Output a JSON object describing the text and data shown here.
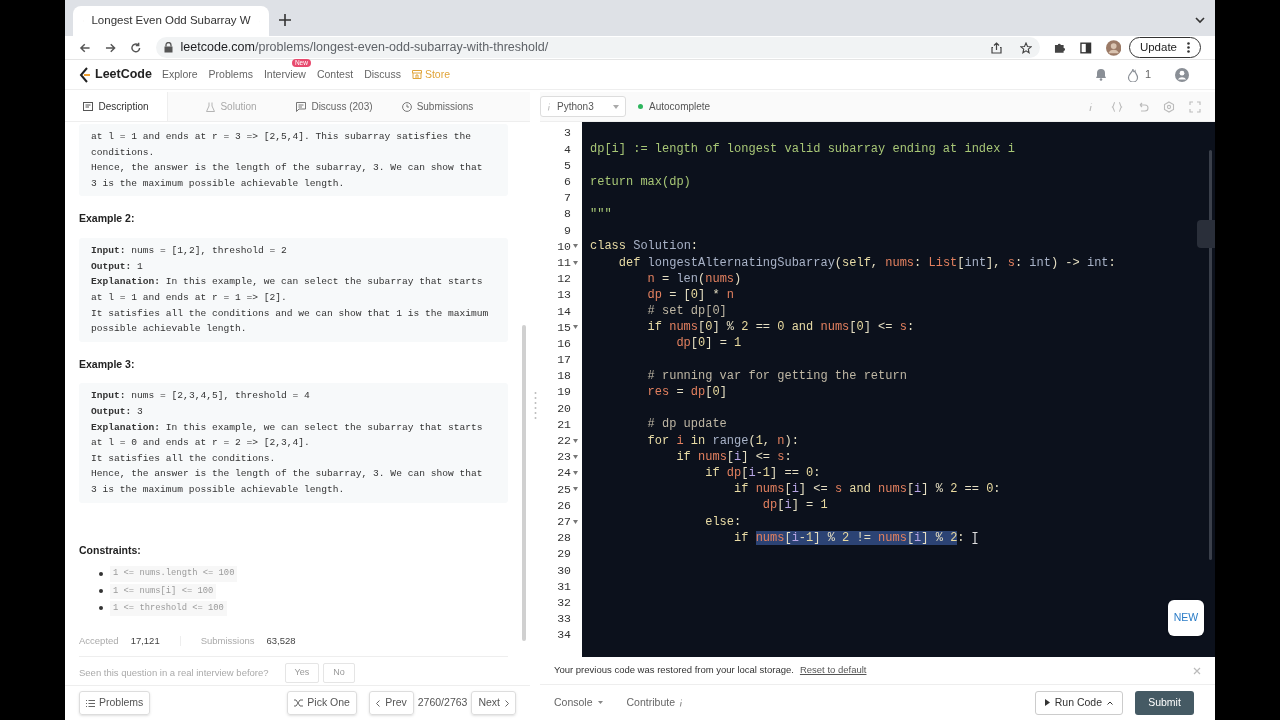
{
  "browser": {
    "tab_title": "Longest Even Odd Subarray W",
    "url_domain": "leetcode.com",
    "url_path": "/problems/longest-even-odd-subarray-with-threshold/",
    "update_label": "Update"
  },
  "nav": {
    "brand": "LeetCode",
    "links": [
      {
        "label": "Explore",
        "kind": "plain"
      },
      {
        "label": "Problems",
        "kind": "plain"
      },
      {
        "label": "Interview",
        "kind": "badged",
        "badge": "New"
      },
      {
        "label": "Contest",
        "kind": "plain"
      },
      {
        "label": "Discuss",
        "kind": "plain"
      },
      {
        "label": "Store",
        "kind": "store"
      }
    ],
    "streak": "1"
  },
  "panel_tabs": [
    {
      "label": "Description",
      "selected": true,
      "disabled": false
    },
    {
      "label": "Solution",
      "selected": false,
      "disabled": true
    },
    {
      "label": "Discuss (203)",
      "selected": false,
      "disabled": false
    },
    {
      "label": "Submissions",
      "selected": false,
      "disabled": false
    }
  ],
  "description": [
    {
      "kind": "box",
      "lines": [
        "at l = 1 and ends at r = 3 => [2,5,4]. This subarray satisfies the",
        "conditions.",
        "Hence, the answer is the length of the subarray, 3. We can show that",
        "3 is the maximum possible achievable length."
      ]
    },
    {
      "kind": "heading",
      "text": "Example 2:"
    },
    {
      "kind": "box",
      "lines": [
        "**Input:** nums = [1,2], threshold = 2",
        "**Output:** 1",
        "**Explanation:** In this example, we can select the subarray that starts",
        "at l = 1 and ends at r = 1 => [2].",
        "It satisfies all the conditions and we can show that 1 is the maximum",
        "possible achievable length."
      ]
    },
    {
      "kind": "heading",
      "text": "Example 3:"
    },
    {
      "kind": "box",
      "lines": [
        "**Input:** nums = [2,3,4,5], threshold = 4",
        "**Output:** 3",
        "**Explanation:** In this example, we can select the subarray that starts",
        "at l = 0 and ends at r = 2 => [2,3,4].",
        "It satisfies all the conditions.",
        "Hence, the answer is the length of the subarray, 3. We can show that",
        "3 is the maximum possible achievable length."
      ]
    },
    {
      "kind": "constraints",
      "title": "Constraints:",
      "items": [
        "1 <= nums.length <= 100",
        "1 <= nums[i] <= 100",
        "1 <= threshold <= 100"
      ]
    }
  ],
  "stats": [
    {
      "label": "Accepted",
      "value": "17,121"
    },
    {
      "label": "Submissions",
      "value": "63,528"
    }
  ],
  "feedback": {
    "question": "Seen this question in a real interview before?",
    "options": [
      "Yes",
      "No"
    ]
  },
  "left_footer": {
    "problems": "Problems",
    "pick_one": "Pick One",
    "prev": "Prev",
    "position": "2760/2763",
    "next": "Next"
  },
  "editor_toolbar": {
    "language": "Python3",
    "autocomplete": "Autocomplete",
    "autocomplete_on": true
  },
  "code_lines": [
    {
      "number": "3",
      "foldable": false
    },
    {
      "number": "4",
      "foldable": false,
      "tokens": [
        {
          "kind": "doc",
          "text": "dp[i] := length of longest valid subarray ending at index i"
        }
      ]
    },
    {
      "number": "5",
      "foldable": false
    },
    {
      "number": "6",
      "foldable": false,
      "tokens": [
        {
          "kind": "doc",
          "text": "return max(dp)"
        }
      ]
    },
    {
      "number": "7",
      "foldable": false
    },
    {
      "number": "8",
      "foldable": false,
      "tokens": [
        {
          "kind": "doc",
          "text": "\"\"\""
        }
      ]
    },
    {
      "number": "9",
      "foldable": false
    },
    {
      "number": "10",
      "foldable": true,
      "tokens": [
        {
          "kind": "kw",
          "text": "class "
        },
        {
          "kind": "name",
          "text": "Solution"
        },
        {
          "kind": "plain",
          "text": ":"
        }
      ]
    },
    {
      "number": "11",
      "foldable": true,
      "tokens": [
        {
          "kind": "kw",
          "text": "    def "
        },
        {
          "kind": "name",
          "text": "longestAlternatingSubarray"
        },
        {
          "kind": "plain",
          "text": "("
        },
        {
          "kind": "kw",
          "text": "self"
        },
        {
          "kind": "plain",
          "text": ", "
        },
        {
          "kind": "var",
          "text": "nums"
        },
        {
          "kind": "plain",
          "text": ": "
        },
        {
          "kind": "var",
          "text": "List"
        },
        {
          "kind": "plain",
          "text": "["
        },
        {
          "kind": "name",
          "text": "int"
        },
        {
          "kind": "plain",
          "text": "], "
        },
        {
          "kind": "var",
          "text": "s"
        },
        {
          "kind": "plain",
          "text": ": "
        },
        {
          "kind": "name",
          "text": "int"
        },
        {
          "kind": "plain",
          "text": ") -> "
        },
        {
          "kind": "name",
          "text": "int"
        },
        {
          "kind": "plain",
          "text": ":"
        }
      ]
    },
    {
      "number": "12",
      "foldable": false,
      "tokens": [
        {
          "kind": "var",
          "text": "        n"
        },
        {
          "kind": "plain",
          "text": " = "
        },
        {
          "kind": "name",
          "text": "len"
        },
        {
          "kind": "plain",
          "text": "("
        },
        {
          "kind": "var",
          "text": "nums"
        },
        {
          "kind": "plain",
          "text": ")"
        }
      ]
    },
    {
      "number": "13",
      "foldable": false,
      "tokens": [
        {
          "kind": "var",
          "text": "        dp"
        },
        {
          "kind": "plain",
          "text": " = ["
        },
        {
          "kind": "num",
          "text": "0"
        },
        {
          "kind": "plain",
          "text": "] * "
        },
        {
          "kind": "var",
          "text": "n"
        }
      ]
    },
    {
      "number": "14",
      "foldable": false,
      "tokens": [
        {
          "kind": "comment",
          "text": "        # set dp[0]"
        }
      ]
    },
    {
      "number": "15",
      "foldable": true,
      "tokens": [
        {
          "kind": "kw",
          "text": "        if "
        },
        {
          "kind": "var",
          "text": "nums"
        },
        {
          "kind": "plain",
          "text": "["
        },
        {
          "kind": "num",
          "text": "0"
        },
        {
          "kind": "plain",
          "text": "] % "
        },
        {
          "kind": "num",
          "text": "2"
        },
        {
          "kind": "plain",
          "text": " == "
        },
        {
          "kind": "num",
          "text": "0"
        },
        {
          "kind": "kw",
          "text": " and "
        },
        {
          "kind": "var",
          "text": "nums"
        },
        {
          "kind": "plain",
          "text": "["
        },
        {
          "kind": "num",
          "text": "0"
        },
        {
          "kind": "plain",
          "text": "] <= "
        },
        {
          "kind": "var",
          "text": "s"
        },
        {
          "kind": "plain",
          "text": ":"
        }
      ]
    },
    {
      "number": "16",
      "foldable": false,
      "tokens": [
        {
          "kind": "var",
          "text": "            dp"
        },
        {
          "kind": "plain",
          "text": "["
        },
        {
          "kind": "num",
          "text": "0"
        },
        {
          "kind": "plain",
          "text": "] = "
        },
        {
          "kind": "num",
          "text": "1"
        }
      ]
    },
    {
      "number": "17",
      "foldable": false
    },
    {
      "number": "18",
      "foldable": false,
      "tokens": [
        {
          "kind": "comment",
          "text": "        # running var for getting the return"
        }
      ]
    },
    {
      "number": "19",
      "foldable": false,
      "tokens": [
        {
          "kind": "var",
          "text": "        res"
        },
        {
          "kind": "plain",
          "text": " = "
        },
        {
          "kind": "var",
          "text": "dp"
        },
        {
          "kind": "plain",
          "text": "["
        },
        {
          "kind": "num",
          "text": "0"
        },
        {
          "kind": "plain",
          "text": "]"
        }
      ]
    },
    {
      "number": "20",
      "foldable": false
    },
    {
      "number": "21",
      "foldable": false,
      "tokens": [
        {
          "kind": "comment",
          "text": "        # dp update"
        }
      ]
    },
    {
      "number": "22",
      "foldable": true,
      "tokens": [
        {
          "kind": "kw",
          "text": "        for "
        },
        {
          "kind": "var",
          "text": "i"
        },
        {
          "kind": "kw",
          "text": " in "
        },
        {
          "kind": "name",
          "text": "range"
        },
        {
          "kind": "plain",
          "text": "("
        },
        {
          "kind": "num",
          "text": "1"
        },
        {
          "kind": "plain",
          "text": ", "
        },
        {
          "kind": "var",
          "text": "n"
        },
        {
          "kind": "plain",
          "text": "):"
        }
      ]
    },
    {
      "number": "23",
      "foldable": true,
      "tokens": [
        {
          "kind": "kw",
          "text": "            if "
        },
        {
          "kind": "var",
          "text": "nums"
        },
        {
          "kind": "plain",
          "text": "["
        },
        {
          "kind": "idx",
          "text": "i"
        },
        {
          "kind": "plain",
          "text": "] <= "
        },
        {
          "kind": "var",
          "text": "s"
        },
        {
          "kind": "plain",
          "text": ":"
        }
      ]
    },
    {
      "number": "24",
      "foldable": true,
      "tokens": [
        {
          "kind": "kw",
          "text": "                if "
        },
        {
          "kind": "var",
          "text": "dp"
        },
        {
          "kind": "plain",
          "text": "["
        },
        {
          "kind": "idx",
          "text": "i"
        },
        {
          "kind": "plain",
          "text": "-"
        },
        {
          "kind": "num",
          "text": "1"
        },
        {
          "kind": "plain",
          "text": "] == "
        },
        {
          "kind": "num",
          "text": "0"
        },
        {
          "kind": "plain",
          "text": ":"
        }
      ]
    },
    {
      "number": "25",
      "foldable": true,
      "tokens": [
        {
          "kind": "kw",
          "text": "                    if "
        },
        {
          "kind": "var",
          "text": "nums"
        },
        {
          "kind": "plain",
          "text": "["
        },
        {
          "kind": "idx",
          "text": "i"
        },
        {
          "kind": "plain",
          "text": "] <= "
        },
        {
          "kind": "var",
          "text": "s"
        },
        {
          "kind": "kw",
          "text": " and "
        },
        {
          "kind": "var",
          "text": "nums"
        },
        {
          "kind": "plain",
          "text": "["
        },
        {
          "kind": "idx",
          "text": "i"
        },
        {
          "kind": "plain",
          "text": "] % "
        },
        {
          "kind": "num",
          "text": "2"
        },
        {
          "kind": "plain",
          "text": " == "
        },
        {
          "kind": "num",
          "text": "0"
        },
        {
          "kind": "plain",
          "text": ":"
        }
      ]
    },
    {
      "number": "26",
      "foldable": false,
      "tokens": [
        {
          "kind": "var",
          "text": "                        dp"
        },
        {
          "kind": "plain",
          "text": "["
        },
        {
          "kind": "idx",
          "text": "i"
        },
        {
          "kind": "plain",
          "text": "] = "
        },
        {
          "kind": "num",
          "text": "1"
        }
      ]
    },
    {
      "number": "27",
      "foldable": true,
      "tokens": [
        {
          "kind": "kw",
          "text": "                else"
        },
        {
          "kind": "plain",
          "text": ":"
        }
      ]
    },
    {
      "number": "28",
      "foldable": false,
      "tokens": [
        {
          "kind": "kw",
          "text": "                    if "
        }
      ],
      "selected_tokens": [
        {
          "kind": "var",
          "text": "nums"
        },
        {
          "kind": "plain",
          "text": "["
        },
        {
          "kind": "idx",
          "text": "i"
        },
        {
          "kind": "plain",
          "text": "-"
        },
        {
          "kind": "num",
          "text": "1"
        },
        {
          "kind": "plain",
          "text": "] % "
        },
        {
          "kind": "num",
          "text": "2"
        },
        {
          "kind": "plain",
          "text": " != "
        },
        {
          "kind": "var",
          "text": "nums"
        },
        {
          "kind": "plain",
          "text": "["
        },
        {
          "kind": "idx",
          "text": "i"
        },
        {
          "kind": "plain",
          "text": "] % "
        },
        {
          "kind": "num",
          "text": "2"
        }
      ],
      "tokens_after": [
        {
          "kind": "plain",
          "text": ":"
        }
      ]
    },
    {
      "number": "29",
      "foldable": false
    },
    {
      "number": "30",
      "foldable": false
    },
    {
      "number": "31",
      "foldable": false
    },
    {
      "number": "32",
      "foldable": false
    },
    {
      "number": "33",
      "foldable": false
    },
    {
      "number": "34",
      "foldable": false
    }
  ],
  "new_button": "NEW",
  "notice": {
    "text": "Your previous code was restored from your local storage.",
    "link": "Reset to default"
  },
  "right_footer": {
    "console": "Console",
    "contribute": "Contribute",
    "run": "Run Code",
    "submit": "Submit"
  }
}
